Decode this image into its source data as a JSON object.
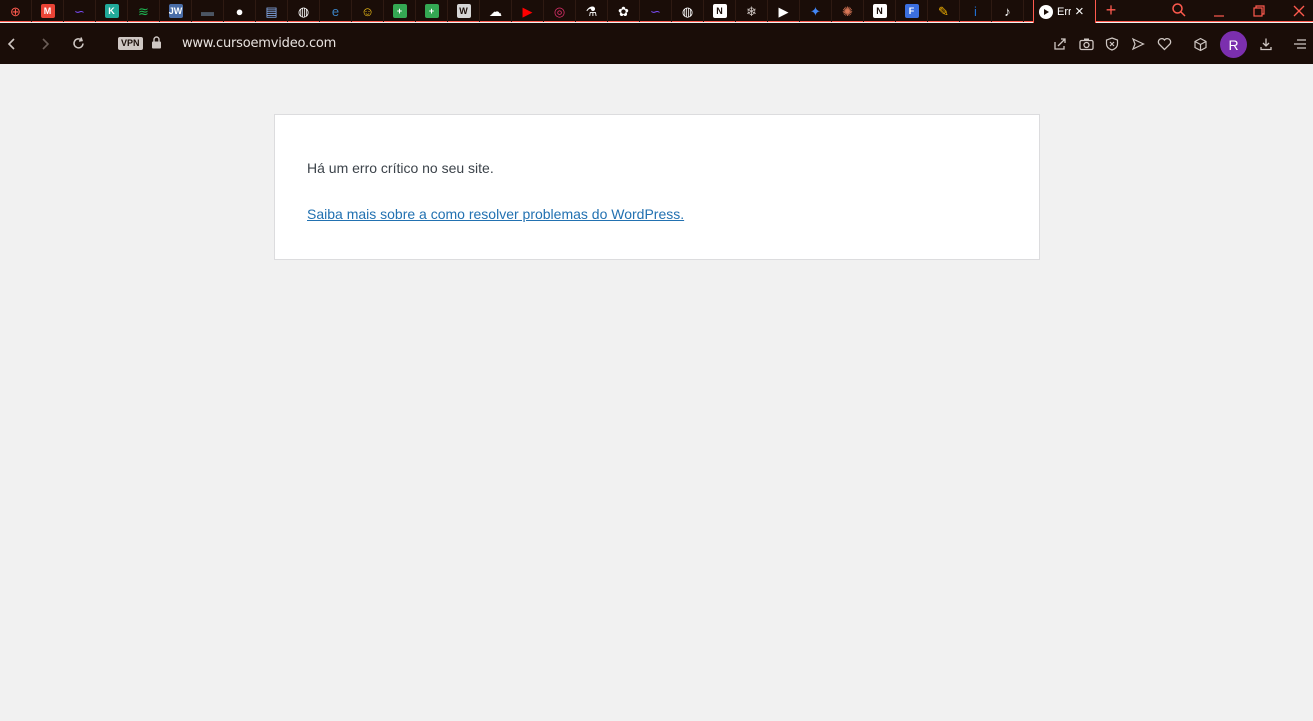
{
  "browser": {
    "active_tab": {
      "title": "Err",
      "icon": "youtube-play-icon"
    },
    "pinned_tabs": [
      {
        "name": "gamepad-tab",
        "icon": "gamepad-icon",
        "glyph": "⊕",
        "color": "#ff5a4e"
      },
      {
        "name": "gmail-tab",
        "icon": "gmail-icon",
        "glyph": "M",
        "color": "#ea4335"
      },
      {
        "name": "wave-tab",
        "icon": "wave-icon",
        "glyph": "∽",
        "color": "#7c4dff"
      },
      {
        "name": "k-tab",
        "icon": "k-app-icon",
        "glyph": "K",
        "color": "#21a99a"
      },
      {
        "name": "spotify-tab",
        "icon": "spotify-icon",
        "glyph": "≋",
        "color": "#1db954"
      },
      {
        "name": "jw-tab",
        "icon": "jw-icon",
        "glyph": "JW",
        "color": "#4a6da7"
      },
      {
        "name": "drive-tab",
        "icon": "storage-icon",
        "glyph": "▬",
        "color": "#4b5563"
      },
      {
        "name": "github-tab",
        "icon": "github-icon",
        "glyph": "●",
        "color": "#ffffff"
      },
      {
        "name": "docs-tab",
        "icon": "document-icon",
        "glyph": "▤",
        "color": "#8ab4f8"
      },
      {
        "name": "globe-tab-1",
        "icon": "globe-icon",
        "glyph": "◍",
        "color": "#ffffff"
      },
      {
        "name": "edge-tab",
        "icon": "browser-icon",
        "glyph": "e",
        "color": "#3b82c4"
      },
      {
        "name": "emoji-tab",
        "icon": "emoji-icon",
        "glyph": "☺",
        "color": "#f5c518"
      },
      {
        "name": "sheets-tab-1",
        "icon": "spreadsheet-icon",
        "glyph": "+",
        "color": "#34a853"
      },
      {
        "name": "sheets-tab-2",
        "icon": "spreadsheet-icon",
        "glyph": "+",
        "color": "#34a853"
      },
      {
        "name": "wordpress-tab",
        "icon": "wordpress-icon",
        "glyph": "W",
        "color": "#d6d6d6"
      },
      {
        "name": "cloud-tab",
        "icon": "cloud-icon",
        "glyph": "☁",
        "color": "#ffffff"
      },
      {
        "name": "youtube-tab",
        "icon": "youtube-icon",
        "glyph": "▶",
        "color": "#ff0000"
      },
      {
        "name": "instagram-tab",
        "icon": "instagram-icon",
        "glyph": "◎",
        "color": "#e1306c"
      },
      {
        "name": "labs-tab",
        "icon": "flask-icon",
        "glyph": "⚗",
        "color": "#ffffff"
      },
      {
        "name": "chatgpt-tab",
        "icon": "openai-icon",
        "glyph": "✿",
        "color": "#ffffff"
      },
      {
        "name": "wave-tab-2",
        "icon": "wave-icon",
        "glyph": "∽",
        "color": "#7c4dff"
      },
      {
        "name": "globe-tab-2",
        "icon": "globe-icon",
        "glyph": "◍",
        "color": "#ffffff"
      },
      {
        "name": "notion-n-tab",
        "icon": "n-app-icon",
        "glyph": "N",
        "color": "#ffffff"
      },
      {
        "name": "snowflake-tab",
        "icon": "snowflake-icon",
        "glyph": "❄",
        "color": "#cfc7c3"
      },
      {
        "name": "youtube-tab-2",
        "icon": "youtube-icon",
        "glyph": "▶",
        "color": "#ffffff"
      },
      {
        "name": "gemini-tab",
        "icon": "sparkle-icon",
        "glyph": "✦",
        "color": "#4285f4"
      },
      {
        "name": "claude-tab",
        "icon": "claude-icon",
        "glyph": "✺",
        "color": "#d97757"
      },
      {
        "name": "notion-tab",
        "icon": "notion-icon",
        "glyph": "N",
        "color": "#ffffff"
      },
      {
        "name": "forms-tab",
        "icon": "forms-icon",
        "glyph": "F",
        "color": "#3b6fe0"
      },
      {
        "name": "pencil-tab",
        "icon": "pencil-icon",
        "glyph": "✎",
        "color": "#f5b400"
      },
      {
        "name": "info-tab",
        "icon": "info-icon",
        "glyph": "i",
        "color": "#1f6fd1"
      },
      {
        "name": "tiktok-tab",
        "icon": "tiktok-icon",
        "glyph": "♪",
        "color": "#ffffff"
      }
    ],
    "vpn_label": "VPN",
    "url": "www.cursoemvideo.com",
    "avatar_letter": "R",
    "accent_color": "#ff5a4e"
  },
  "page": {
    "error_message": "Há um erro crítico no seu site.",
    "help_link": "Saiba mais sobre a como resolver problemas do WordPress."
  }
}
